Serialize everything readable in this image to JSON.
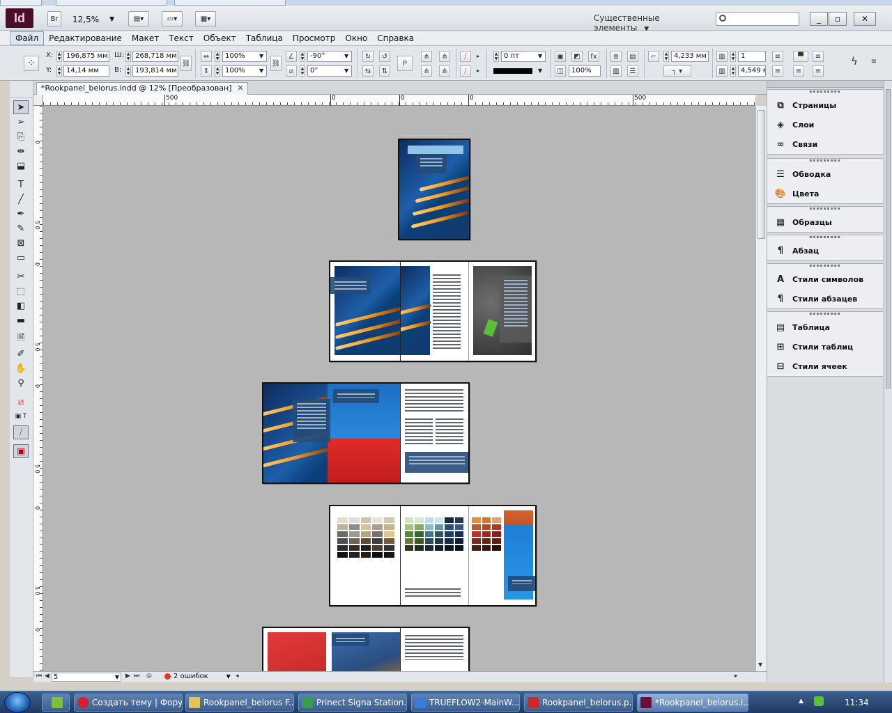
{
  "app": {
    "logo": "Id",
    "bridge_label": "Br",
    "zoom": "12,5%",
    "workspace": "Существенные элементы",
    "window_buttons": [
      "_",
      "▫",
      "✕"
    ]
  },
  "menu": [
    "Файл",
    "Редактирование",
    "Макет",
    "Текст",
    "Объект",
    "Таблица",
    "Просмотр",
    "Окно",
    "Справка"
  ],
  "control": {
    "x_label": "X:",
    "x_value": "196,875 мм",
    "y_label": "Y:",
    "y_value": "14,14 мм",
    "w_label": "Ш:",
    "w_value": "268,718 мм",
    "h_label": "В:",
    "h_value": "193,814 мм",
    "scale_x": "100%",
    "scale_y": "100%",
    "rotate": "-90°",
    "shear": "0°",
    "stroke_weight": "0 пт",
    "opacity": "100%",
    "gap": "4,233 мм",
    "columns": "1",
    "column_gap": "4,549 м"
  },
  "document": {
    "tab_title": "*Rookpanel_belorus.indd @ 12% [Преобразован]",
    "tab_close": "✕"
  },
  "ruler": {
    "h_labels": [
      "500",
      "0",
      "0",
      "0",
      "500"
    ],
    "v_labels": [
      "0",
      "5 0",
      "0",
      "5 0",
      "0",
      "5 0",
      "0",
      "5 0",
      "0"
    ]
  },
  "status": {
    "page": "5",
    "errors": "2 ошибок"
  },
  "panels": {
    "groups": [
      [
        {
          "icon": "pages-icon",
          "label": "Страницы"
        },
        {
          "icon": "layers-icon",
          "label": "Слои"
        },
        {
          "icon": "links-icon",
          "label": "Связи"
        }
      ],
      [
        {
          "icon": "stroke-icon",
          "label": "Обводка"
        },
        {
          "icon": "color-icon",
          "label": "Цвета"
        }
      ],
      [
        {
          "icon": "swatches-icon",
          "label": "Образцы"
        }
      ],
      [
        {
          "icon": "paragraph-icon",
          "label": "Абзац"
        }
      ],
      [
        {
          "icon": "character-styles-icon",
          "label": "Стили символов"
        },
        {
          "icon": "paragraph-styles-icon",
          "label": "Стили абзацев"
        }
      ],
      [
        {
          "icon": "table-icon",
          "label": "Таблица"
        },
        {
          "icon": "table-styles-icon",
          "label": "Стили таблиц"
        },
        {
          "icon": "cell-styles-icon",
          "label": "Стили ячеек"
        }
      ]
    ]
  },
  "taskbar": {
    "items": [
      {
        "label": "Создать тему | Фору...",
        "color": "#d9202a"
      },
      {
        "label": "Rookpanel_belorus F...",
        "color": "#e7c25a"
      },
      {
        "label": "Prinect Signa Station...",
        "color": "#3b9c4f"
      },
      {
        "label": "TRUEFLOW2-MainW...",
        "color": "#3e7bd6"
      },
      {
        "label": "Rookpanel_belorus.p...",
        "color": "#c62a2a"
      },
      {
        "label": "*Rookpanel_belorus.i...",
        "color": "#6a1037"
      }
    ],
    "clock": "11:34"
  },
  "colors": {
    "indesign_brand": "#4a0d2a",
    "pasteboard": "#b7b7b7",
    "error_dot": "#e03a25"
  }
}
